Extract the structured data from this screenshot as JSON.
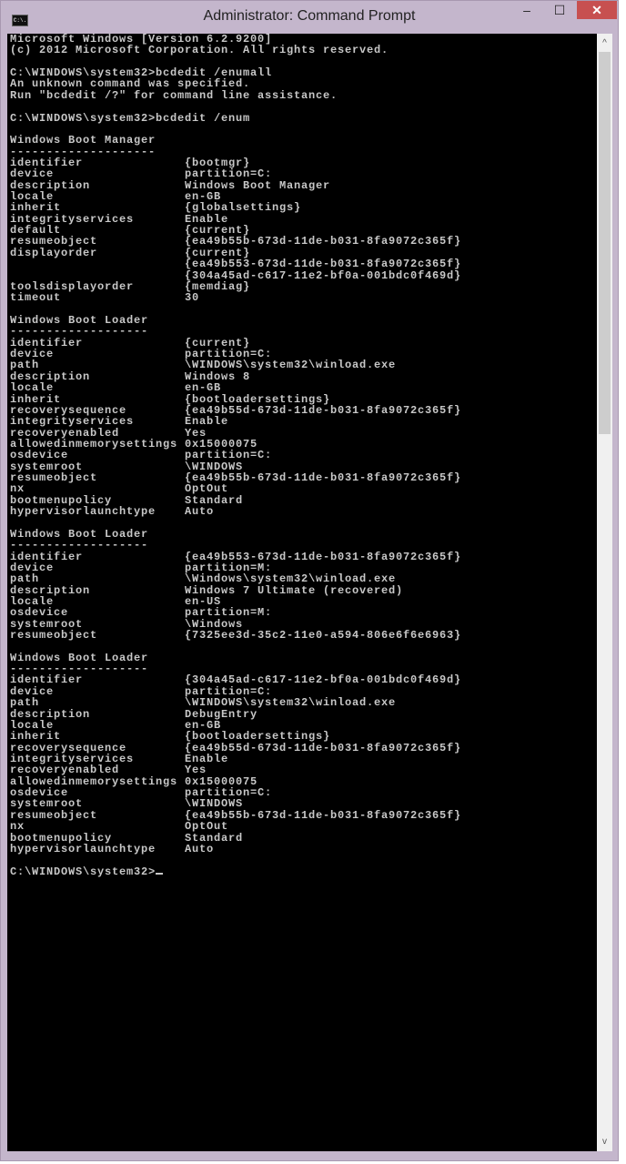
{
  "window": {
    "title": "Administrator: Command Prompt",
    "icon_label": "C:\\.",
    "minimize": "–",
    "maximize": "☐",
    "close": "✕"
  },
  "scrollbar": {
    "up": "^",
    "down": "v"
  },
  "console": {
    "lines": [
      {
        "t": "Microsoft Windows [Version 6.2.9200]"
      },
      {
        "t": "(c) 2012 Microsoft Corporation. All rights reserved."
      },
      {
        "t": ""
      },
      {
        "t": "C:\\WINDOWS\\system32>bcdedit /enumall"
      },
      {
        "t": "An unknown command was specified."
      },
      {
        "t": "Run \"bcdedit /?\" for command line assistance."
      },
      {
        "t": ""
      },
      {
        "t": "C:\\WINDOWS\\system32>bcdedit /enum"
      },
      {
        "t": ""
      },
      {
        "t": "Windows Boot Manager"
      },
      {
        "t": "--------------------"
      },
      {
        "k": "identifier",
        "v": "{bootmgr}"
      },
      {
        "k": "device",
        "v": "partition=C:"
      },
      {
        "k": "description",
        "v": "Windows Boot Manager"
      },
      {
        "k": "locale",
        "v": "en-GB"
      },
      {
        "k": "inherit",
        "v": "{globalsettings}"
      },
      {
        "k": "integrityservices",
        "v": "Enable"
      },
      {
        "k": "default",
        "v": "{current}"
      },
      {
        "k": "resumeobject",
        "v": "{ea49b55b-673d-11de-b031-8fa9072c365f}"
      },
      {
        "k": "displayorder",
        "v": "{current}"
      },
      {
        "k": "",
        "v": "{ea49b553-673d-11de-b031-8fa9072c365f}"
      },
      {
        "k": "",
        "v": "{304a45ad-c617-11e2-bf0a-001bdc0f469d}"
      },
      {
        "k": "toolsdisplayorder",
        "v": "{memdiag}"
      },
      {
        "k": "timeout",
        "v": "30"
      },
      {
        "t": ""
      },
      {
        "t": "Windows Boot Loader"
      },
      {
        "t": "-------------------"
      },
      {
        "k": "identifier",
        "v": "{current}"
      },
      {
        "k": "device",
        "v": "partition=C:"
      },
      {
        "k": "path",
        "v": "\\WINDOWS\\system32\\winload.exe"
      },
      {
        "k": "description",
        "v": "Windows 8"
      },
      {
        "k": "locale",
        "v": "en-GB"
      },
      {
        "k": "inherit",
        "v": "{bootloadersettings}"
      },
      {
        "k": "recoverysequence",
        "v": "{ea49b55d-673d-11de-b031-8fa9072c365f}"
      },
      {
        "k": "integrityservices",
        "v": "Enable"
      },
      {
        "k": "recoveryenabled",
        "v": "Yes"
      },
      {
        "k": "allowedinmemorysettings",
        "v": "0x15000075"
      },
      {
        "k": "osdevice",
        "v": "partition=C:"
      },
      {
        "k": "systemroot",
        "v": "\\WINDOWS"
      },
      {
        "k": "resumeobject",
        "v": "{ea49b55b-673d-11de-b031-8fa9072c365f}"
      },
      {
        "k": "nx",
        "v": "OptOut"
      },
      {
        "k": "bootmenupolicy",
        "v": "Standard"
      },
      {
        "k": "hypervisorlaunchtype",
        "v": "Auto"
      },
      {
        "t": ""
      },
      {
        "t": "Windows Boot Loader"
      },
      {
        "t": "-------------------"
      },
      {
        "k": "identifier",
        "v": "{ea49b553-673d-11de-b031-8fa9072c365f}"
      },
      {
        "k": "device",
        "v": "partition=M:"
      },
      {
        "k": "path",
        "v": "\\Windows\\system32\\winload.exe"
      },
      {
        "k": "description",
        "v": "Windows 7 Ultimate (recovered)"
      },
      {
        "k": "locale",
        "v": "en-US"
      },
      {
        "k": "osdevice",
        "v": "partition=M:"
      },
      {
        "k": "systemroot",
        "v": "\\Windows"
      },
      {
        "k": "resumeobject",
        "v": "{7325ee3d-35c2-11e0-a594-806e6f6e6963}"
      },
      {
        "t": ""
      },
      {
        "t": "Windows Boot Loader"
      },
      {
        "t": "-------------------"
      },
      {
        "k": "identifier",
        "v": "{304a45ad-c617-11e2-bf0a-001bdc0f469d}"
      },
      {
        "k": "device",
        "v": "partition=C:"
      },
      {
        "k": "path",
        "v": "\\WINDOWS\\system32\\winload.exe"
      },
      {
        "k": "description",
        "v": "DebugEntry"
      },
      {
        "k": "locale",
        "v": "en-GB"
      },
      {
        "k": "inherit",
        "v": "{bootloadersettings}"
      },
      {
        "k": "recoverysequence",
        "v": "{ea49b55d-673d-11de-b031-8fa9072c365f}"
      },
      {
        "k": "integrityservices",
        "v": "Enable"
      },
      {
        "k": "recoveryenabled",
        "v": "Yes"
      },
      {
        "k": "allowedinmemorysettings",
        "v": "0x15000075"
      },
      {
        "k": "osdevice",
        "v": "partition=C:"
      },
      {
        "k": "systemroot",
        "v": "\\WINDOWS"
      },
      {
        "k": "resumeobject",
        "v": "{ea49b55b-673d-11de-b031-8fa9072c365f}"
      },
      {
        "k": "nx",
        "v": "OptOut"
      },
      {
        "k": "bootmenupolicy",
        "v": "Standard"
      },
      {
        "k": "hypervisorlaunchtype",
        "v": "Auto"
      },
      {
        "t": ""
      }
    ],
    "prompt": "C:\\WINDOWS\\system32>"
  }
}
